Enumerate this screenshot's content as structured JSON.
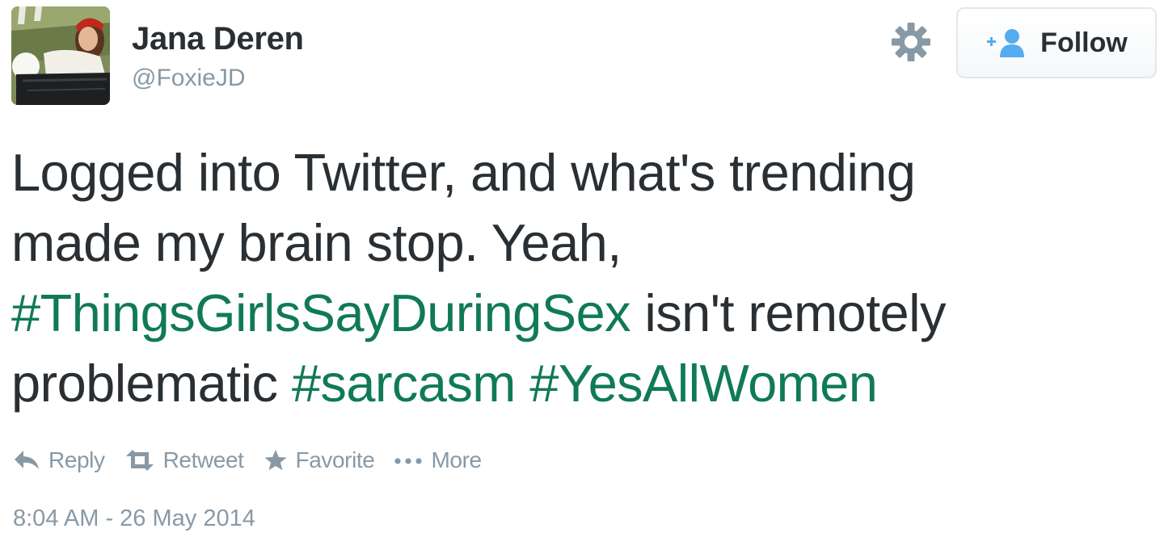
{
  "author": {
    "name": "Jana Deren",
    "handle": "@FoxieJD"
  },
  "follow_button": {
    "label": "Follow",
    "icon": "add-user-icon"
  },
  "settings_icon": "gear-icon",
  "tweet": {
    "lines": [
      [
        {
          "text": "Logged into Twitter, and what's trending",
          "hashtag": false
        }
      ],
      [
        {
          "text": "made my brain stop. Yeah,",
          "hashtag": false
        }
      ],
      [
        {
          "text": "#ThingsGirlsSayDuringSex",
          "hashtag": true
        },
        {
          "text": " isn't remotely",
          "hashtag": false
        }
      ],
      [
        {
          "text": "problematic ",
          "hashtag": false
        },
        {
          "text": "#sarcasm",
          "hashtag": true
        },
        {
          "text": " ",
          "hashtag": false
        },
        {
          "text": "#YesAllWomen",
          "hashtag": true
        }
      ]
    ]
  },
  "actions": {
    "reply": {
      "label": "Reply",
      "icon": "reply-icon"
    },
    "retweet": {
      "label": "Retweet",
      "icon": "retweet-icon"
    },
    "favorite": {
      "label": "Favorite",
      "icon": "star-icon"
    },
    "more": {
      "label": "More",
      "icon": "ellipsis-icon"
    }
  },
  "timestamp": "8:04 AM - 26 May 2014",
  "colors": {
    "text": "#292f33",
    "muted": "#8899a6",
    "hashtag": "#107a57",
    "follow_icon": "#55acee"
  }
}
